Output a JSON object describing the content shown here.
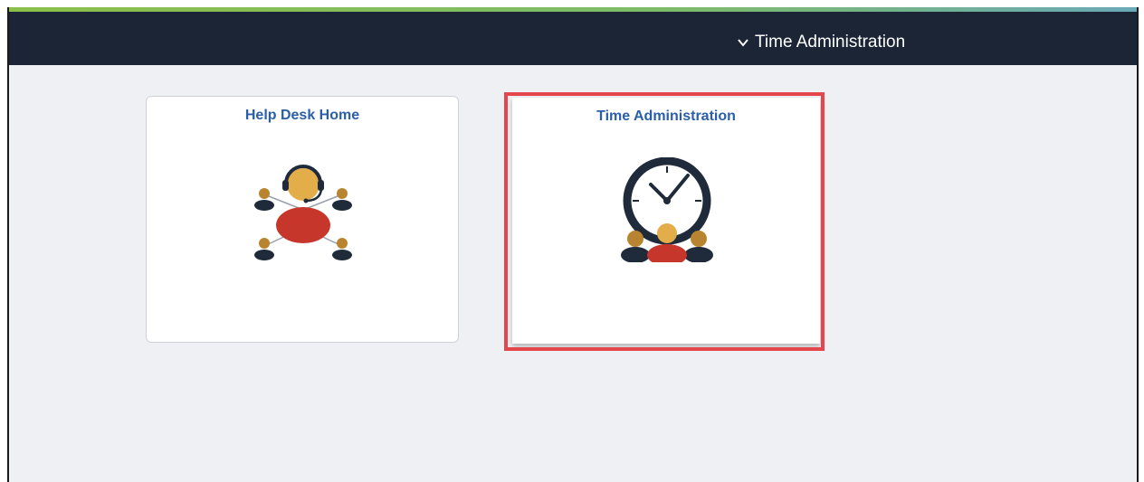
{
  "header": {
    "homepage_selector_label": "Time Administration"
  },
  "tiles": [
    {
      "title": "Help Desk Home",
      "icon": "help-desk-icon"
    },
    {
      "title": "Time Administration",
      "icon": "time-admin-clock-icon"
    }
  ],
  "colors": {
    "banner": "#1b2535",
    "tile_title": "#2a5ea8",
    "highlight": "#e5464b",
    "accent_red": "#c7362a",
    "accent_gold": "#e3ad4a"
  }
}
